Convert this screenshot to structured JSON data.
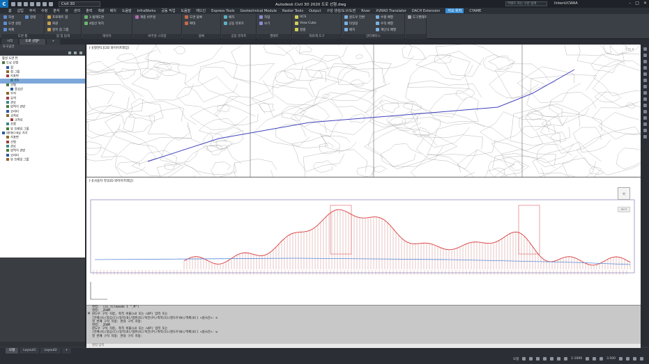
{
  "window": {
    "title": "Autodesk Civil 3D 2020   도로 선형.dwg",
    "workspace": "Civil 3D",
    "search_placeholder": "키워드 또는 구문 입력",
    "user": "linkenUCWAA",
    "controls": [
      "–",
      "□",
      "✕"
    ]
  },
  "menu_tabs": [
    "홈",
    "삽입",
    "주석",
    "수정",
    "분석",
    "뷰",
    "관리",
    "출력",
    "측량",
    "배치",
    "도움말",
    "InfraWorks",
    "공동 작업",
    "도움말",
    "애드인",
    "Express Tools",
    "Geotechnical Module",
    "Raster Tools",
    "Output",
    "구성 생성/도구/도면",
    "River",
    "XVRAO Translator",
    "DACH Extension",
    "지오 위치",
    "CYAME"
  ],
  "active_menu_tab": "지오 위치",
  "ribbon": {
    "groups": [
      {
        "title": "도면 툴",
        "items": [
          "작성",
          "도면 설정",
          "복제",
          "정렬"
        ]
      },
      {
        "title": "점 및 탐색",
        "items": [
          "프로젝트 점",
          "복원",
          "항목 점 그룹"
        ]
      },
      {
        "title": "레이어",
        "items": [
          "1-법제도면",
          "4법선 위치"
        ]
      },
      {
        "title": "비주얼 스타일",
        "items": [
          "계층 비주얼"
        ]
      },
      {
        "title": "블록",
        "items": [
          "도면 블록",
          "확대"
        ]
      },
      {
        "title": "공동 뷰포트",
        "items": [
          "배치",
          "공동 뷰포트"
        ]
      },
      {
        "title": "팔레트",
        "items": [
          "작업",
          "보기"
        ]
      },
      {
        "title": "좌표계 도구",
        "items": [
          "UCS",
          "View Cube",
          "정렬"
        ]
      },
      {
        "title": "인터페이스",
        "items": [
          "윈도우 전환",
          "타일링",
          "배치",
          "수평 배열",
          "수직 배열",
          "계단식 배열"
        ]
      },
      {
        "title": "",
        "items": [
          "도구팔레트"
        ]
      }
    ]
  },
  "file_tabs": [
    {
      "label": "시작",
      "active": false
    },
    {
      "label": "도로 선형*",
      "active": true
    },
    {
      "label": "+",
      "active": false
    }
  ],
  "toolspace": {
    "title": "도구공간",
    "tree_root": "활성 도면 뷰",
    "items": [
      {
        "label": "도로 선형",
        "level": 0
      },
      {
        "label": "점",
        "level": 1
      },
      {
        "label": "점 그룹",
        "level": 1
      },
      {
        "label": "지표면",
        "level": 1
      },
      {
        "label": "EG",
        "level": 2
      },
      {
        "label": "선형",
        "level": 1
      },
      {
        "label": "중심선",
        "level": 2
      },
      {
        "label": "부지",
        "level": 1
      },
      {
        "label": "유역",
        "level": 1
      },
      {
        "label": "관로",
        "level": 1
      },
      {
        "label": "압력식 관망",
        "level": 1
      },
      {
        "label": "코리더",
        "level": 1
      },
      {
        "label": "교차로",
        "level": 1
      },
      {
        "label": "교차로",
        "level": 2
      },
      {
        "label": "조합",
        "level": 1
      },
      {
        "label": "뷰 프레임 그룹",
        "level": 1
      },
      {
        "label": "데이터 바로 가기",
        "level": 0
      },
      {
        "label": "지표면",
        "level": 1
      },
      {
        "label": "선형",
        "level": 1
      },
      {
        "label": "관로",
        "level": 1
      },
      {
        "label": "압력식 관망",
        "level": 1
      },
      {
        "label": "코리더",
        "level": 1
      },
      {
        "label": "뷰 프레임 그룹",
        "level": 1
      }
    ],
    "selected_index": 4
  },
  "viewport": {
    "plan_label": "[-][평면도][2D 와이어프레임]",
    "profile_label": "[-][사용자 뷰][2D 와이어프레임]",
    "viewcube_label": "위",
    "wcs_label": "WCS"
  },
  "command_history": [
    "명령:  (ai_tilemode 1 \"_M\")",
    "명령: _ZOOM",
    "윈도우 구석 지정, 축척 비율(nX 또는 nXP) 입력 또는",
    "[전체(A)/중심(C)/동적(D)/범위(E)/이전(P)/축척(S)/윈도우(W)/객체(O)] <실시간>: e",
    "첫 번째 구석 지정: 반대 구석 지정:",
    "명령: _ZOOM",
    "윈도우 구석 지정, 축척 비율(nX 또는 nXP) 입력 또는",
    "[전체(A)/중심(C)/동적(D)/범위(E)/이전(P)/축척(S)/윈도우(W)/객체(O)] <실시간>: w",
    "첫 번째 구석 지정: 반대 구석 지정:"
  ],
  "command_input_placeholder": "명령 입력",
  "layout_tabs": [
    {
      "label": "모형",
      "active": true
    },
    {
      "label": "Layout1",
      "active": false
    },
    {
      "label": "Layout2",
      "active": false
    },
    {
      "label": "+",
      "active": false
    }
  ],
  "status_bar": {
    "model": "모형",
    "scale": "1:1000",
    "value": "3.500"
  },
  "colors": {
    "accent": "#3a8fd6",
    "dark_bg": "#33363c",
    "profile_red": "#d93a3a",
    "alignment_blue": "#4040c0"
  }
}
